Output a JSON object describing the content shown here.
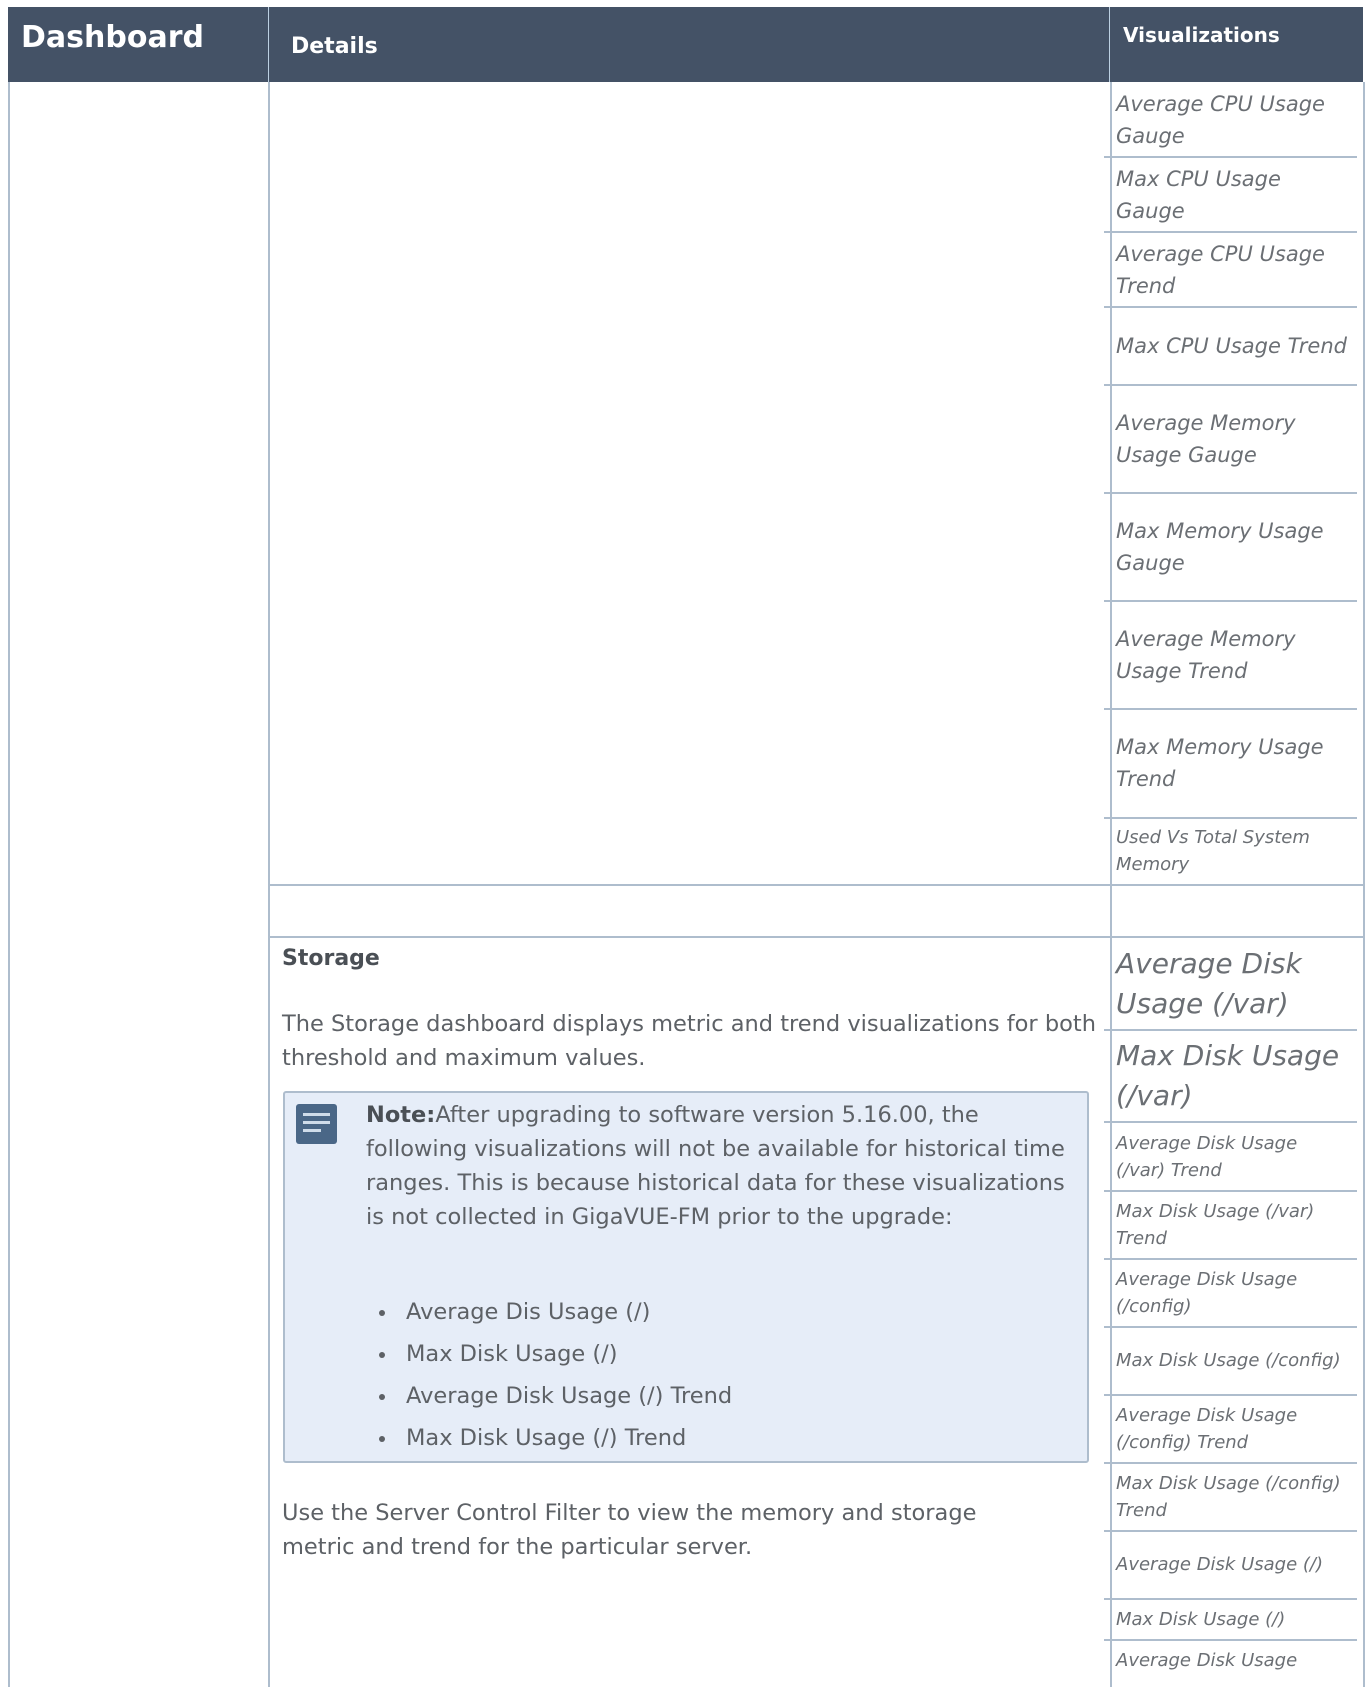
{
  "header": {
    "col_dashboard": "Dashboard",
    "col_details": "Details",
    "col_visualizations": "Visualizations"
  },
  "visualizations_upper": [
    "Average CPU Usage Gauge",
    "Max CPU Usage Gauge",
    "Average CPU Usage Trend",
    "Max CPU Usage Trend",
    "Average Memory Usage Gauge",
    "Max Memory Usage Gauge",
    "Average Memory Usage Trend",
    "Max Memory Usage Trend",
    "Used Vs Total System Memory"
  ],
  "storage": {
    "title": "Storage",
    "description": "The Storage dashboard displays metric and trend visualizations for both threshold and maximum values.",
    "note_label": "Note:",
    "note_text": "After upgrading to software version 5.16.00, the following visualizations will not be available for historical time ranges. This is because historical data for these visualizations is not collected in GigaVUE-FM prior to the upgrade:",
    "note_items": [
      "Average Dis Usage (/)",
      "Max Disk Usage (/)",
      "Average Disk Usage (/) Trend",
      "Max Disk Usage (/) Trend"
    ],
    "footer_text": "Use the Server Control Filter to view the memory and storage metric and trend for the particular server.",
    "visualizations": [
      "Average Disk Usage (/var)",
      "Max Disk Usage (/var)",
      "Average Disk Usage (/var) Trend",
      "Max Disk Usage (/var) Trend",
      "Average Disk Usage (/config)",
      "Max Disk Usage (/config)",
      "Average Disk Usage (/config) Trend",
      "Max Disk Usage (/config) Trend",
      "Average Disk Usage (/)",
      "Max Disk Usage (/)",
      "Average Disk Usage"
    ]
  },
  "colors": {
    "header_bg": "#445266",
    "border": "#aebdcd",
    "note_bg": "#e6edf8",
    "note_icon": "#4a6787"
  },
  "icons": {
    "note": "note-icon"
  }
}
